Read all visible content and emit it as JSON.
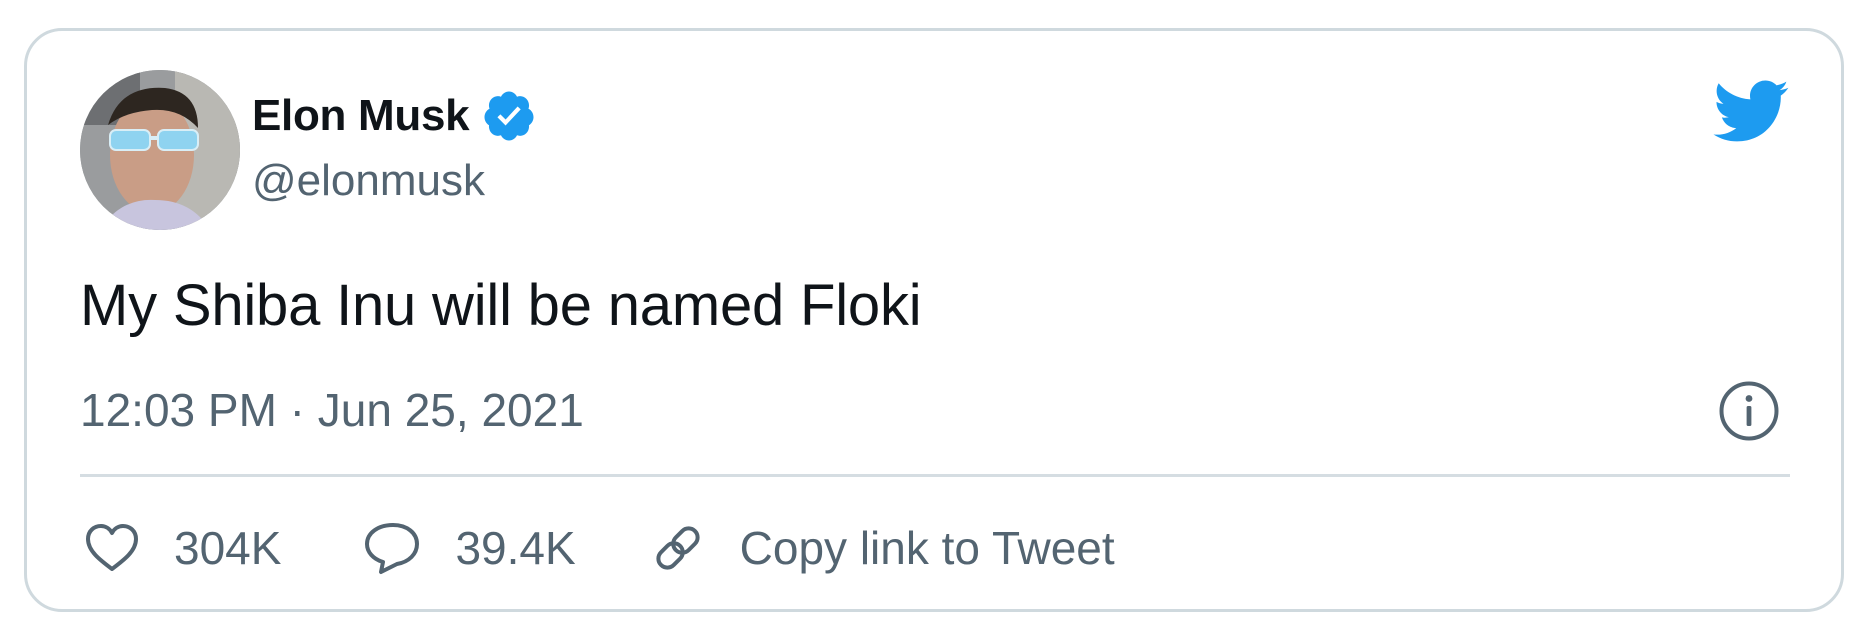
{
  "tweet": {
    "author": {
      "display_name": "Elon Musk",
      "handle": "@elonmusk",
      "verified": true
    },
    "text": "My Shiba Inu will be named Floki",
    "timestamp": "12:03 PM · Jun 25, 2021"
  },
  "actions": {
    "likes": "304K",
    "replies": "39.4K",
    "copy_link_label": "Copy link to Tweet"
  },
  "icons": {
    "brand": "twitter-bird-icon",
    "verified": "verified-badge-icon",
    "info": "info-icon",
    "like": "heart-icon",
    "reply": "speech-bubble-icon",
    "copy_link": "link-icon"
  },
  "colors": {
    "brand_blue": "#1d9bf0",
    "text_primary": "#0f1419",
    "text_secondary": "#536471",
    "border": "#cfd9de"
  }
}
